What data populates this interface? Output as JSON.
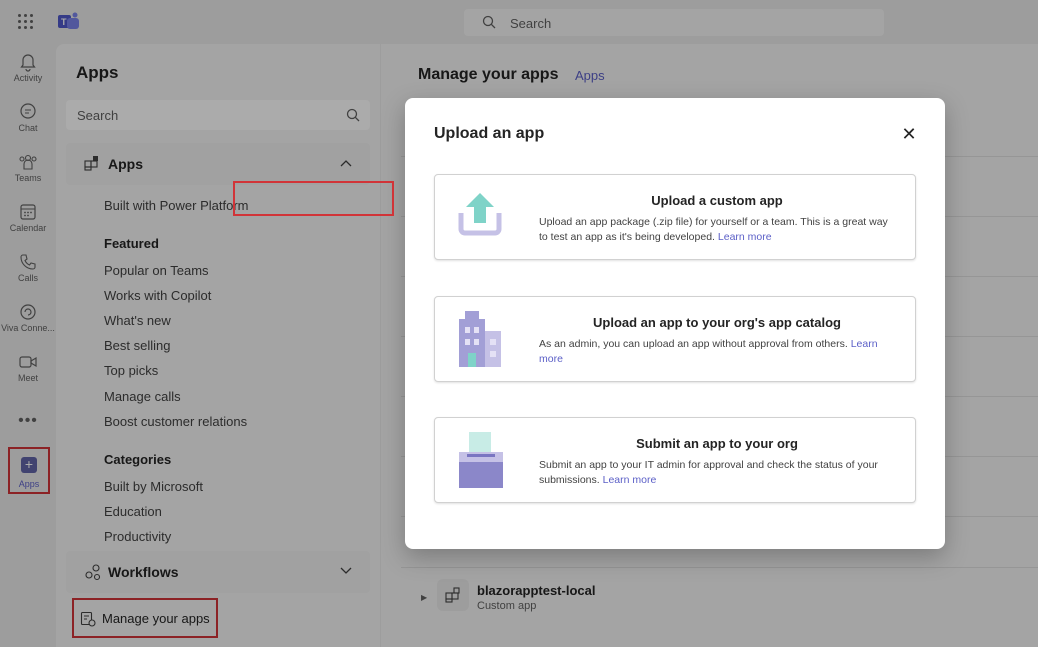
{
  "topbar": {
    "search_placeholder": "Search"
  },
  "rail": {
    "items": [
      {
        "label": "Activity"
      },
      {
        "label": "Chat"
      },
      {
        "label": "Teams"
      },
      {
        "label": "Calendar"
      },
      {
        "label": "Calls"
      },
      {
        "label": "Viva Conne..."
      },
      {
        "label": "Meet"
      }
    ],
    "more": "•••",
    "apps_label": "Apps"
  },
  "panel": {
    "title": "Apps",
    "search_placeholder": "Search",
    "apps_section": "Apps",
    "built_with": "Built with Power Platform",
    "featured_heading": "Featured",
    "featured": [
      "Popular on Teams",
      "Works with Copilot",
      "What's new",
      "Best selling",
      "Top picks",
      "Manage calls",
      "Boost customer relations"
    ],
    "categories_heading": "Categories",
    "categories": [
      "Built by Microsoft",
      "Education",
      "Productivity"
    ],
    "workflows_section": "Workflows",
    "manage_apps": "Manage your apps"
  },
  "main": {
    "title": "Manage your apps",
    "breadcrumb": "Apps",
    "row": {
      "name": "blazorapptest-local",
      "subtitle": "Custom app"
    }
  },
  "dialog": {
    "title": "Upload an app",
    "close_glyph": "✕",
    "cards": [
      {
        "title": "Upload a custom app",
        "description": "Upload an app package (.zip file) for yourself or a team. This is a great way to test an app as it's being developed.",
        "link": "Learn more"
      },
      {
        "title": "Upload an app to your org's app catalog",
        "description": "As an admin, you can upload an app without approval from others.",
        "link": "Learn more"
      },
      {
        "title": "Submit an app to your org",
        "description": "Submit an app to your IT admin for approval and check the status of your submissions.",
        "link": "Learn more"
      }
    ]
  },
  "colors": {
    "accent": "#5b5fc7",
    "highlight": "#d13438",
    "teal": "#7fd3c8",
    "lavender": "#c5c1e6"
  }
}
